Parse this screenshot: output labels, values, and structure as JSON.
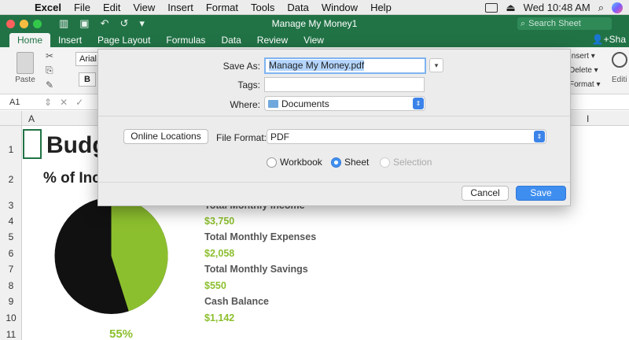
{
  "menubar": {
    "app": "Excel",
    "items": [
      "File",
      "Edit",
      "View",
      "Insert",
      "Format",
      "Tools",
      "Data",
      "Window",
      "Help"
    ],
    "clock": "Wed 10:48 AM"
  },
  "titlebar": {
    "doc_title": "Manage My Money1",
    "search_placeholder": "Search Sheet"
  },
  "ribbon": {
    "tabs": [
      "Home",
      "Insert",
      "Page Layout",
      "Formulas",
      "Data",
      "Review",
      "View"
    ],
    "share": "Sha",
    "paste": "Paste",
    "font": "Arial",
    "bold": "B",
    "insert": "Insert",
    "delete": "Delete",
    "format": "Format",
    "editing": "Editi"
  },
  "formula_bar": {
    "name_box": "A1"
  },
  "columns": {
    "a": "A",
    "i": "I"
  },
  "rows": [
    "1",
    "2",
    "3",
    "4",
    "5",
    "6",
    "7",
    "8",
    "9",
    "10",
    "11"
  ],
  "sheet": {
    "title": "Budg",
    "subtitle": "% of Inc",
    "pie_label": "55%",
    "income_label": "Total Monthly Income",
    "income_value": "$3,750",
    "expenses_label": "Total Monthly Expenses",
    "expenses_value": "$2,058",
    "savings_label": "Total Monthly Savings",
    "savings_value": "$550",
    "cash_label": "Cash Balance",
    "cash_value": "$1,142"
  },
  "pie": {
    "green_fraction": 0.45,
    "green": "#8cbf2e",
    "black": "#111111"
  },
  "dialog": {
    "save_as_label": "Save As:",
    "save_as_value": "Manage My Money.pdf",
    "tags_label": "Tags:",
    "tags_value": "",
    "where_label": "Where:",
    "where_value": "Documents",
    "online_locations": "Online Locations",
    "file_format_label": "File Format:",
    "file_format_value": "PDF",
    "radio_workbook": "Workbook",
    "radio_sheet": "Sheet",
    "radio_selection": "Selection",
    "cancel": "Cancel",
    "save": "Save"
  },
  "colors": {
    "excel_green": "#217346",
    "accent_blue": "#3e8ef0"
  }
}
